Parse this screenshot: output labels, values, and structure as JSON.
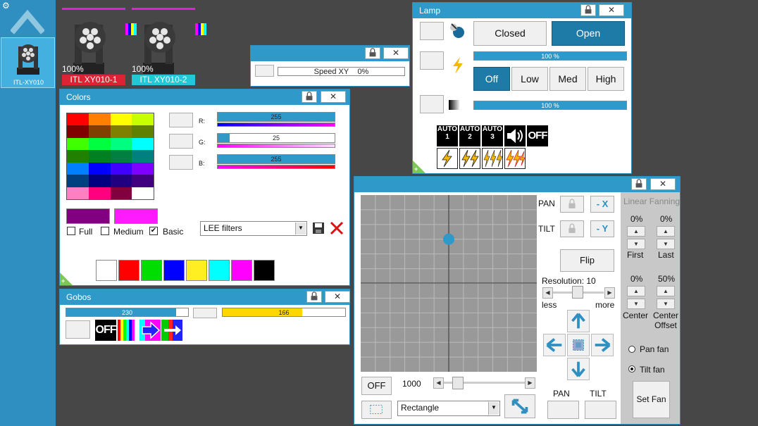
{
  "colors": {
    "accent": "#2f99c9",
    "sidebar": "#2f8fc0",
    "background": "#474747",
    "magenta": "#dd22dd",
    "red_name": "#dd2233",
    "cyan_name": "#22c8d8"
  },
  "sidebar": {
    "device_label": "ITL-XY010",
    "settings_icon": "gear-icon",
    "up_icon": "chevron-up-icon"
  },
  "fixtures": [
    {
      "percent": "100%",
      "name": "ITL XY010-1",
      "name_color": "#dd2233"
    },
    {
      "percent": "100%",
      "name": "ITL XY010-2",
      "name_color": "#22c8d8"
    }
  ],
  "speed_window": {
    "label": "Speed XY",
    "value": "0%"
  },
  "colors_window": {
    "title": "Colors",
    "grid": [
      [
        "#ff0000",
        "#ff8000",
        "#ffff00",
        "#c8ff00"
      ],
      [
        "#800000",
        "#804000",
        "#808000",
        "#608000"
      ],
      [
        "#40ff00",
        "#00ff40",
        "#00ff80",
        "#00ffff"
      ],
      [
        "#208000",
        "#008020",
        "#008040",
        "#008080"
      ],
      [
        "#0080ff",
        "#0000ff",
        "#4000ff",
        "#8000ff"
      ],
      [
        "#004080",
        "#000080",
        "#200080",
        "#400080"
      ],
      [
        "#ff80c0",
        "#ff0080",
        "#800040",
        "#ffffff"
      ]
    ],
    "r_label": "R:",
    "r_value": "255",
    "r_fraction": 1.0,
    "g_label": "G:",
    "g_value": "25",
    "g_fraction": 0.1,
    "b_label": "B:",
    "b_value": "255",
    "b_fraction": 1.0,
    "current_color": "#800080",
    "preview_color": "#ff1aff",
    "full_label": "Full",
    "medium_label": "Medium",
    "basic_label": "Basic",
    "filter_select": "LEE filters",
    "bottom_swatches": [
      "#ffffff",
      "#ff0000",
      "#00dd00",
      "#0000ff",
      "#ffee22",
      "#00ffff",
      "#ff00ff",
      "#000000"
    ]
  },
  "gobos_window": {
    "title": "Gobos",
    "slider_value": "230",
    "slider_fraction": 0.9,
    "yellow_value": "166",
    "yellow_fraction": 0.65,
    "off_label": "OFF"
  },
  "lamp_window": {
    "title": "Lamp",
    "closed_label": "Closed",
    "open_label": "Open",
    "bar1_value": "100 %",
    "off_label": "Off",
    "low_label": "Low",
    "med_label": "Med",
    "high_label": "High",
    "bar2_value": "100 %",
    "auto1": "AUTO 1",
    "auto2": "AUTO 2",
    "auto3": "AUTO 3",
    "off_icon": "OFF"
  },
  "xy_window": {
    "pan_label": "PAN",
    "tilt_label": "TILT",
    "minus_x": "- X",
    "minus_y": "- Y",
    "flip_label": "Flip",
    "resolution_label": "Resolution: 10",
    "less_label": "less",
    "more_label": "more",
    "off_label": "OFF",
    "count_value": "1000",
    "shape_select": "Rectangle",
    "pan_bottom": "PAN",
    "tilt_bottom": "TILT",
    "point_x": 0.5,
    "point_y": 0.25
  },
  "fanning": {
    "title": "Linear Fanning",
    "first_value": "0%",
    "first_label": "First",
    "last_value": "0%",
    "last_label": "Last",
    "center_value": "0%",
    "center_label": "Center",
    "offset_value": "50%",
    "offset_label": "Center Offset",
    "pan_fan_label": "Pan fan",
    "tilt_fan_label": "Tilt fan",
    "set_fan_label": "Set Fan"
  }
}
